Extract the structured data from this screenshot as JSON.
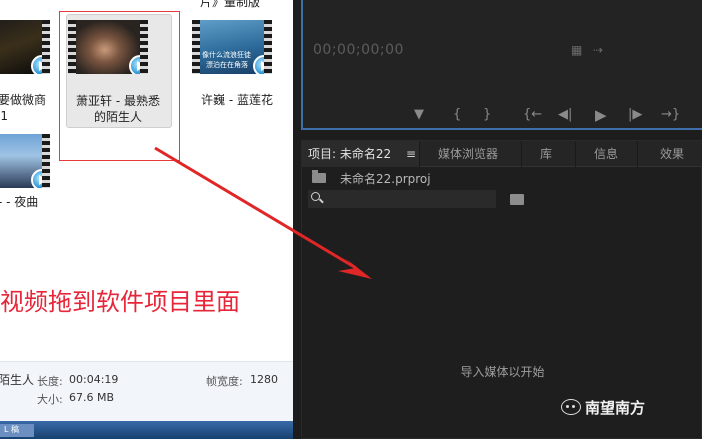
{
  "explorer": {
    "files": [
      {
        "name_top": "要做微商",
        "name_bottom": "-1"
      },
      {
        "name_top": "萧亚轩 - 最熟悉",
        "name_bottom": "的陌生人"
      },
      {
        "name_top": "许巍 - 蓝莲花"
      },
      {
        "name_top": "- - 夜曲"
      }
    ],
    "top_cut_label": "片》量制版",
    "thumb3_caption_1": "像什么流浪狂徒",
    "thumb3_caption_2": "漂泊在在角落",
    "instruction": "视频拖到软件项目里面",
    "details": {
      "name": "陌生人",
      "length_label": "长度:",
      "length_value": "00:04:19",
      "size_label": "大小:",
      "size_value": "67.6 MB",
      "framewidth_label": "帧宽度:",
      "framewidth_value": "1280"
    },
    "taskbar_item": "L 稿"
  },
  "premiere": {
    "monitor": {
      "timecode": "00;00;00;00"
    },
    "tabs": [
      {
        "label": "项目: 未命名22",
        "active": true
      },
      {
        "label": "媒体浏览器"
      },
      {
        "label": "库"
      },
      {
        "label": "信息"
      },
      {
        "label": "效果"
      }
    ],
    "tab_menu": "≡",
    "project_file": "未命名22.prproj",
    "empty_message": "导入媒体以开始",
    "icons": [
      "marker-icon",
      "mark-in-icon",
      "mark-out-icon",
      "go-to-in-icon",
      "step-back-icon",
      "play-icon",
      "step-forward-icon",
      "go-to-out-icon"
    ],
    "controls": [
      "▼",
      "{",
      "}",
      "{←",
      "◀|",
      "▶",
      "|▶",
      "→}"
    ]
  },
  "watermark": "南望南方",
  "colors": {
    "accent_blue": "#3e6fa8",
    "annotation_red": "#e8263a",
    "premiere_bg": "#1d1d1d"
  }
}
